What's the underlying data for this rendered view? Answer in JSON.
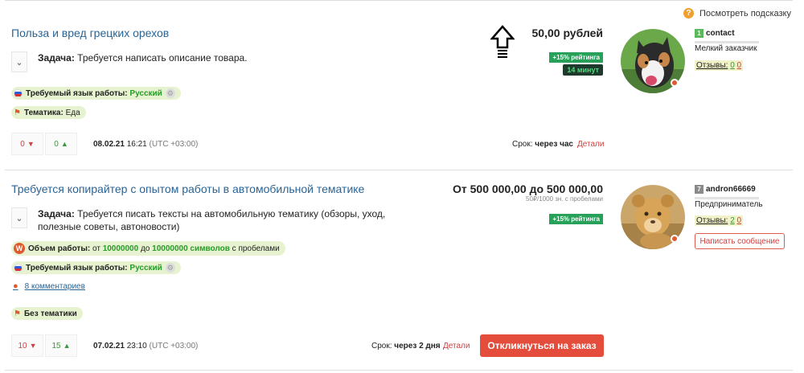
{
  "hint": {
    "label": "Посмотреть подсказку"
  },
  "orders": [
    {
      "title": "Польза и вред грецких орехов",
      "task_label": "Задача:",
      "task_text": "Требуется написать описание товара.",
      "language_label": "Требуемый язык работы:",
      "language_value": "Русский",
      "topic_label": "Тематика:",
      "topic_value": "Еда",
      "votes_neg": "0",
      "votes_pos": "0",
      "date": "08.02.21",
      "time": "16:21",
      "timezone": "(UTC +03:00)",
      "deadline_label": "Срок:",
      "deadline_value": "через час",
      "details": "Детали",
      "price": "50,00 рублей",
      "rating_badge": "+15% рейтинга",
      "time_badge": "14 минут",
      "user": {
        "level": "1",
        "level_color": "#5cb85c",
        "name": "contact",
        "role": "Мелкий заказчик",
        "reviews_label": "Отзывы:",
        "reviews_pos": "0",
        "reviews_neg": "0"
      }
    },
    {
      "title": "Требуется копирайтер с опытом работы в автомобильной тематике",
      "task_label": "Задача:",
      "task_text": "Требуется писать тексты на автомобильную тематику (обзоры, уход, полезные советы, автоновости)",
      "volume_label": "Объем работы:",
      "volume_from": "от",
      "volume_min": "10000000",
      "volume_to": "до",
      "volume_max": "10000000 символов",
      "volume_suffix": "с пробелами",
      "language_label": "Требуемый язык работы:",
      "language_value": "Русский",
      "comments": "8 комментариев",
      "topic_value": "Без тематики",
      "votes_neg": "10",
      "votes_pos": "15",
      "date": "07.02.21",
      "time": "23:10",
      "timezone": "(UTC +03:00)",
      "deadline_label": "Срок:",
      "deadline_value": "через 2 дня",
      "details": "Детали",
      "respond": "Откликнуться на заказ",
      "price": "От 500 000,00 до 500 000,00",
      "price_sub": "50₽/1000 зн. с пробелами",
      "rating_badge": "+15% рейтинга",
      "user": {
        "level": "7",
        "level_color": "#8a8a8a",
        "name": "andron66669",
        "role": "Предприниматель",
        "reviews_label": "Отзывы:",
        "reviews_pos": "2",
        "reviews_neg": "0",
        "message": "Написать сообщение"
      }
    }
  ],
  "colors": {
    "link": "#2a6496",
    "accent_red": "#e44c3c",
    "badge_green": "#27a05a",
    "pill_bg": "#e7f3d0"
  }
}
